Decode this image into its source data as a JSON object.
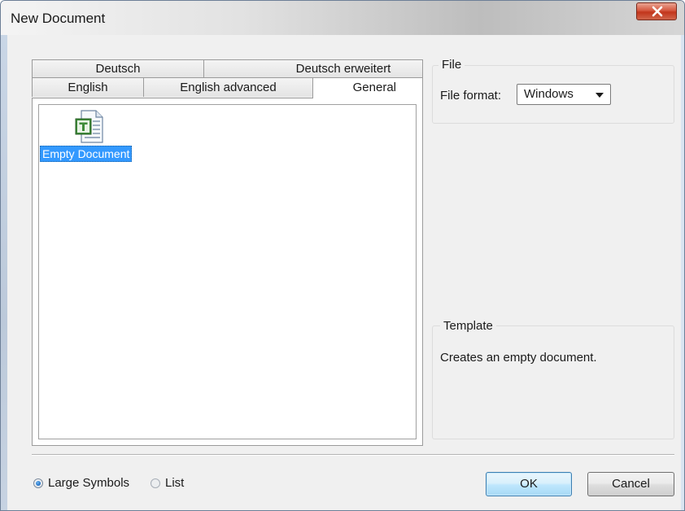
{
  "window": {
    "title": "New Document"
  },
  "tabs": {
    "row1": [
      {
        "label": "Deutsch"
      },
      {
        "label": "Deutsch erweitert"
      }
    ],
    "row2": [
      {
        "label": "English"
      },
      {
        "label": "English advanced"
      },
      {
        "label": "General",
        "active": true
      }
    ]
  },
  "documents": [
    {
      "label": "Empty Document",
      "icon": "text-document-icon",
      "selected": true
    }
  ],
  "file_group": {
    "legend": "File",
    "format_label": "File format:",
    "format_value": "Windows"
  },
  "template_group": {
    "legend": "Template",
    "description": "Creates an empty document."
  },
  "view_mode": {
    "large_symbols": "Large Symbols",
    "list": "List",
    "selected": "large_symbols"
  },
  "buttons": {
    "ok": "OK",
    "cancel": "Cancel"
  },
  "colors": {
    "selection": "#3399ff",
    "icon_green": "#3f8b3a",
    "close_red": "#c94a2f"
  }
}
